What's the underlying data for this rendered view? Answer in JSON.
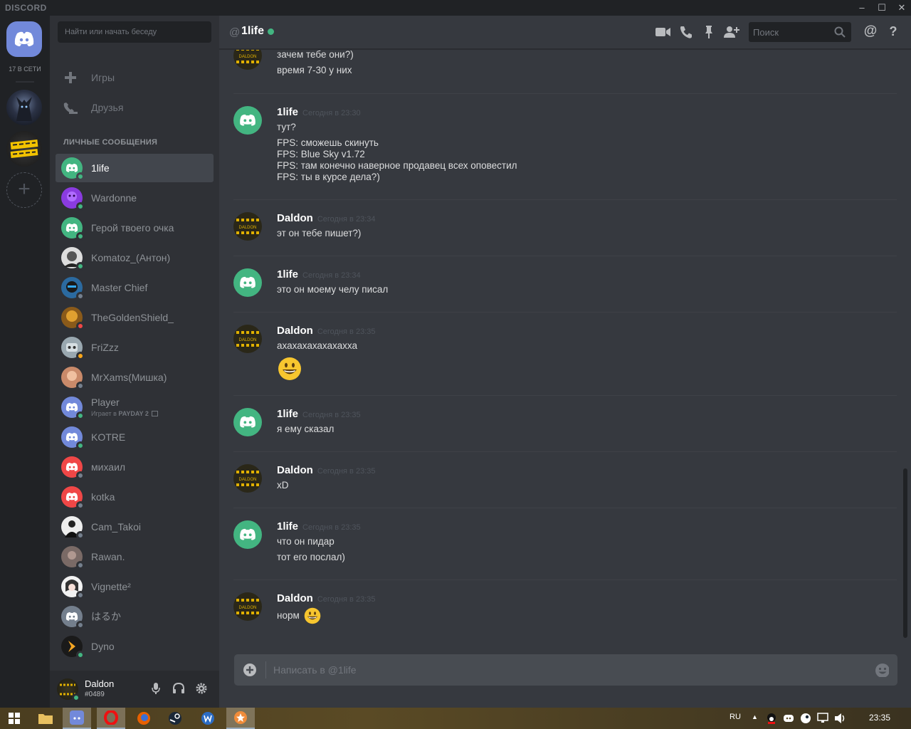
{
  "app": {
    "brand": "DISCORD"
  },
  "guilds": {
    "online_count": "17 В СЕТИ"
  },
  "sidebar": {
    "search_placeholder": "Найти или начать беседу",
    "nav": [
      {
        "label": "Игры",
        "icon": "gamepad-icon"
      },
      {
        "label": "Друзья",
        "icon": "friends-icon"
      }
    ],
    "dm_header": "Личные сообщения",
    "dms": [
      {
        "name": "1life",
        "status": "online",
        "avatar": "discord-green",
        "active": true
      },
      {
        "name": "Wardonne",
        "status": "online",
        "avatar": "purple"
      },
      {
        "name": "Герой твоего очка",
        "status": "online",
        "avatar": "discord-green"
      },
      {
        "name": "Komatoz_(Антон)",
        "status": "online",
        "avatar": "face-bw"
      },
      {
        "name": "Master Chief",
        "status": "offline",
        "avatar": "face-dark"
      },
      {
        "name": "TheGoldenShield_",
        "status": "dnd",
        "avatar": "gold"
      },
      {
        "name": "FriZzz",
        "status": "idle",
        "avatar": "robot"
      },
      {
        "name": "MrXams(Мишка)",
        "status": "offline",
        "avatar": "face-warm"
      },
      {
        "name": "Player",
        "status": "online",
        "avatar": "discord-blurple",
        "activity_prefix": "Играет в ",
        "activity_game": "PAYDAY 2"
      },
      {
        "name": "KOTRE",
        "status": "online",
        "avatar": "discord-blurple"
      },
      {
        "name": "михаил",
        "status": "offline",
        "avatar": "discord-red"
      },
      {
        "name": "kotka",
        "status": "offline",
        "avatar": "discord-red"
      },
      {
        "name": "Cam_Takoi",
        "status": "offline",
        "avatar": "face-suit"
      },
      {
        "name": "Rawan.",
        "status": "offline",
        "avatar": "face-grey"
      },
      {
        "name": "Vignette²",
        "status": "offline",
        "avatar": "anime"
      },
      {
        "name": "はるか",
        "status": "offline",
        "avatar": "discord-grey"
      },
      {
        "name": "Dyno",
        "status": "online",
        "avatar": "dyno"
      }
    ]
  },
  "userbar": {
    "name": "Daldon",
    "tag": "#0489"
  },
  "header": {
    "at": "@",
    "title": "1life",
    "search_placeholder": "Поиск",
    "mention": "@",
    "help": "?"
  },
  "messages": [
    {
      "author": "",
      "time": "",
      "avatar": "daldon",
      "lines": [
        "зачем тебе они?)",
        "время 7-30 у них"
      ]
    },
    {
      "author": "1life",
      "time": "Сегодня в 23:30",
      "avatar": "discord-green",
      "lines": [
        "тут?",
        "FPS: сможешь скинуть",
        "FPS: Blue Sky v1.72",
        "FPS: там конечно наверное продавец всех оповестил",
        "FPS: ты в курсе дела?)"
      ]
    },
    {
      "author": "Daldon",
      "time": "Сегодня в 23:34",
      "avatar": "daldon",
      "lines": [
        "эт он тебе пишет?)"
      ]
    },
    {
      "author": "1life",
      "time": "Сегодня в 23:34",
      "avatar": "discord-green",
      "lines": [
        "это он моему челу писал"
      ]
    },
    {
      "author": "Daldon",
      "time": "Сегодня в 23:35",
      "avatar": "daldon",
      "lines": [
        "ахахахахахахахха"
      ]
    },
    {
      "author": "1life",
      "time": "Сегодня в 23:35",
      "avatar": "discord-green",
      "lines": [
        "я ему сказал"
      ]
    },
    {
      "author": "Daldon",
      "time": "Сегодня в 23:35",
      "avatar": "daldon",
      "lines": [
        "xD"
      ]
    },
    {
      "author": "1life",
      "time": "Сегодня в 23:35",
      "avatar": "discord-green",
      "lines": [
        "что он пидар",
        "тот его послал)"
      ]
    },
    {
      "author": "Daldon",
      "time": "Сегодня в 23:35",
      "avatar": "daldon",
      "lines": [
        "норм"
      ]
    }
  ],
  "composer": {
    "placeholder": "Написать в @1life"
  },
  "taskbar": {
    "lang": "RU",
    "clock": "23:35"
  },
  "colors": {
    "online": "#43b581",
    "idle": "#faa61a",
    "dnd": "#f04747",
    "offline": "#747f8d",
    "blurple": "#7289da"
  }
}
